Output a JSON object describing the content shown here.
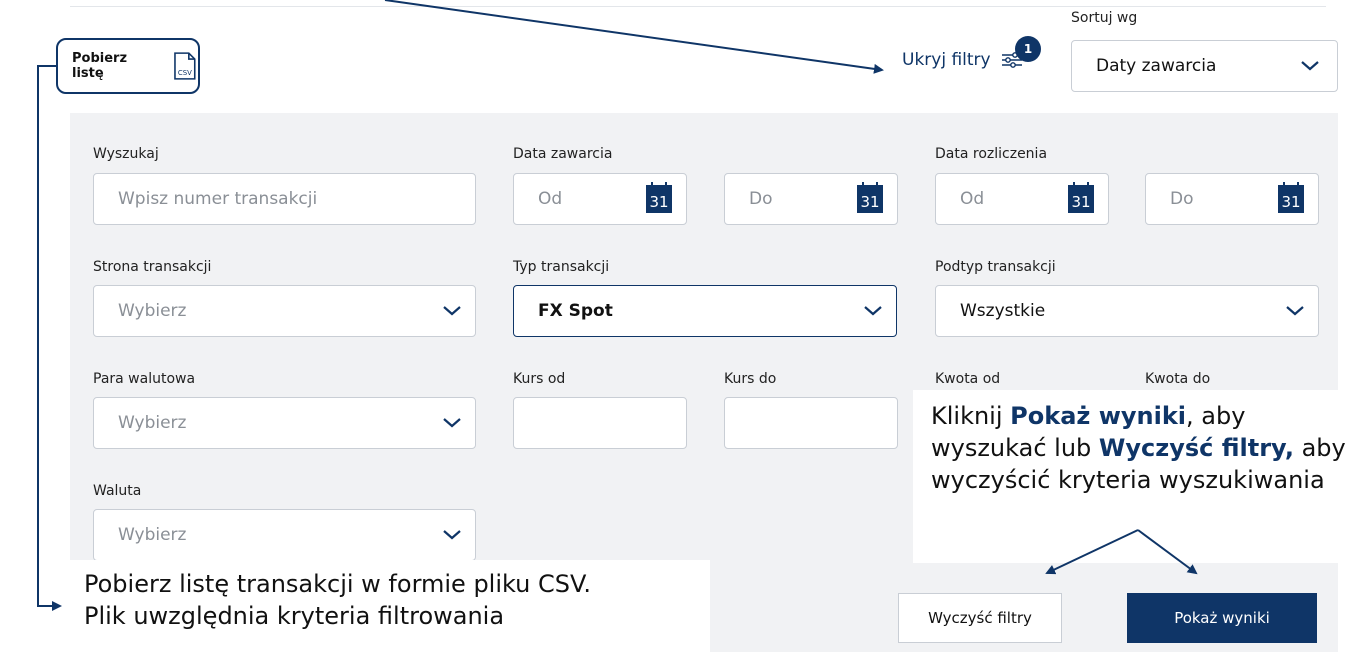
{
  "header": {
    "download_label": "Pobierz listę",
    "csv_icon_text": "CSV",
    "hide_filters_label": "Ukryj filtry",
    "filter_count": "1",
    "sort_label": "Sortuj wg",
    "sort_value": "Daty zawarcia"
  },
  "filters": {
    "search": {
      "label": "Wyszukaj",
      "placeholder": "Wpisz numer transakcji"
    },
    "trade_date": {
      "label": "Data zawarcia",
      "from": "Od",
      "to": "Do"
    },
    "settle_date": {
      "label": "Data rozliczenia",
      "from": "Od",
      "to": "Do"
    },
    "calendar_day": "31",
    "side": {
      "label": "Strona transakcji",
      "value": "Wybierz"
    },
    "type": {
      "label": "Typ transakcji",
      "value": "FX Spot"
    },
    "subtype": {
      "label": "Podtyp transakcji",
      "value": "Wszystkie"
    },
    "pair": {
      "label": "Para walutowa",
      "value": "Wybierz"
    },
    "rate_from": {
      "label": "Kurs od"
    },
    "rate_to": {
      "label": "Kurs do"
    },
    "amount_from": {
      "label": "Kwota od"
    },
    "amount_to": {
      "label": "Kwota do"
    },
    "currency": {
      "label": "Waluta",
      "value": "Wybierz"
    }
  },
  "actions": {
    "clear": "Wyczyść filtry",
    "show": "Pokaż wyniki"
  },
  "annotations": {
    "results_pre": "Kliknij ",
    "results_bold1": "Pokaż wyniki",
    "results_mid": ", aby wyszukać lub ",
    "results_bold2": "Wyczyść filtry,",
    "results_post": " aby wyczyścić kryteria wyszukiwania",
    "csv_line1": "Pobierz listę transakcji w formie pliku CSV.",
    "csv_line2": "Plik uwzględnia kryteria filtrowania"
  },
  "colors": {
    "accent": "#0f3567",
    "panel": "#f1f2f4",
    "border": "#c9ced5"
  }
}
